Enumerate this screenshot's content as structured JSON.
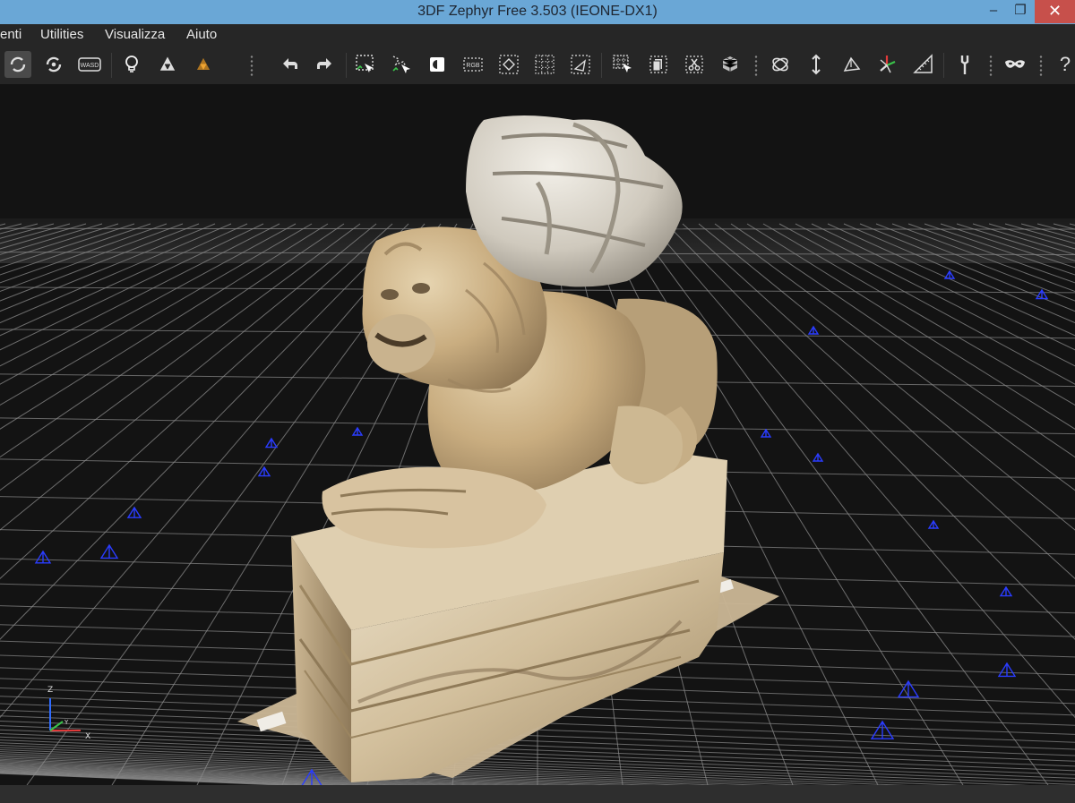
{
  "window": {
    "title": "3DF Zephyr Free 3.503 (IEONE-DX1)",
    "minimize_glyph": "–",
    "restore_glyph": "❐",
    "close_glyph": "✕"
  },
  "menu": {
    "items": [
      "enti",
      "Utilities",
      "Visualizza",
      "Aiuto"
    ]
  },
  "toolbar": {
    "wasd_label": "WASD",
    "rgb_label": "RGB",
    "help_glyph": "?"
  },
  "viewport": {
    "axis": {
      "z": "Z",
      "y": "Y",
      "x": "X"
    },
    "colors": {
      "background": "#131313",
      "grid": "#8c8c8c",
      "camera": "#2a3cff"
    }
  }
}
